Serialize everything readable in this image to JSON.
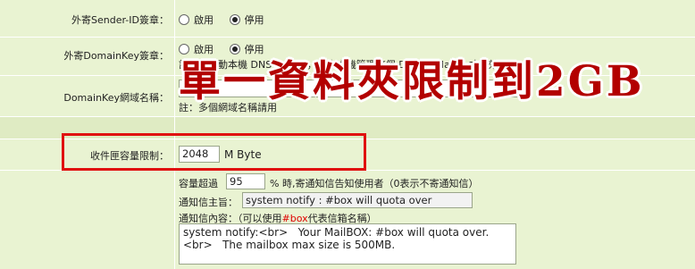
{
  "overlay_text": "單一資料夾限制到2GB",
  "sender_id": {
    "label": "外寄Sender-ID簽章：",
    "options": [
      "啟用",
      "停用"
    ],
    "selected": "停用"
  },
  "domainkey_sig": {
    "label": "外寄DomainKey簽章：",
    "options": [
      "啟用",
      "停用"
    ],
    "selected": "停用",
    "note": "註：需啟動本機 DNS Server，並由本機管理這個 DomainName 才有效。"
  },
  "domainkey_name": {
    "label": "DomainKey網域名稱：",
    "value": "",
    "note": "註：多個網域名稱請用"
  },
  "mailbox_limit": {
    "label": "收件匣容量限制：",
    "value": "2048",
    "unit": "M Byte"
  },
  "quota_notify": {
    "prefix": "容量超過",
    "percent": "95",
    "suffix": "% 時,寄通知信告知使用者（0表示不寄通知信）",
    "subject_label": "通知信主旨：",
    "subject_value": "system notify : #box will quota over",
    "content_label_pre": "通知信內容：（可以使用",
    "content_label_var": "#box",
    "content_label_post": "代表信箱名稱）",
    "content_value": "system notify:<br>   Your MailBOX: #box will quota over.\n<br>   The mailbox max size is 500MB."
  }
}
